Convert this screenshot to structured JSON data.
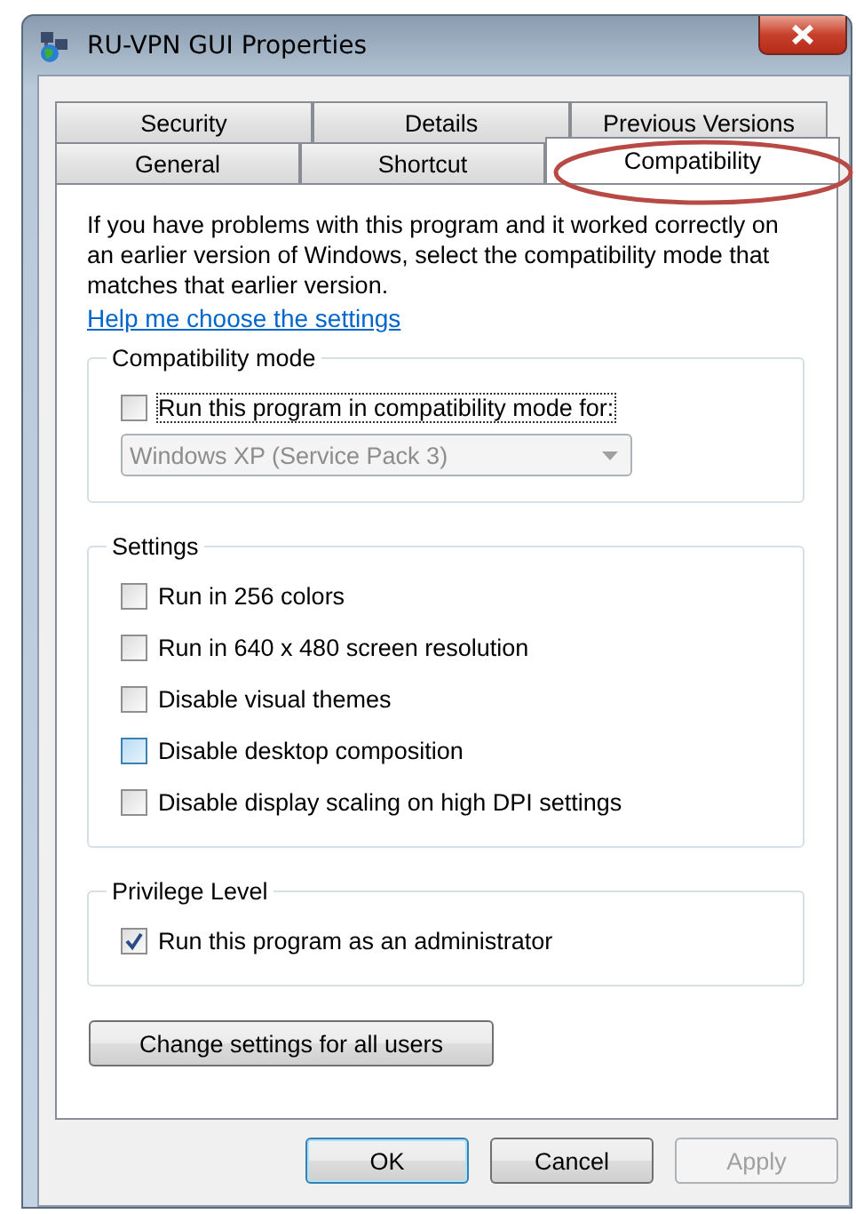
{
  "window": {
    "title": "RU-VPN GUI Properties"
  },
  "tab_rows": [
    [
      {
        "label": "Security",
        "selected": false
      },
      {
        "label": "Details",
        "selected": false
      },
      {
        "label": "Previous Versions",
        "selected": false
      }
    ],
    [
      {
        "label": "General",
        "selected": false
      },
      {
        "label": "Shortcut",
        "selected": false
      },
      {
        "label": "Compatibility",
        "selected": true,
        "circled": true
      }
    ]
  ],
  "intro": "If you have problems with this program and it worked correctly on an earlier version of Windows, select the compatibility mode that matches that earlier version.",
  "help_link": "Help me choose the settings",
  "groups": [
    {
      "title": "Compatibility mode",
      "checkboxes": [
        {
          "label": "Run this program in compatibility mode for:",
          "checked": false,
          "hovered": false,
          "focused": true
        }
      ],
      "dropdown": {
        "value": "Windows XP (Service Pack 3)",
        "disabled": true
      }
    },
    {
      "title": "Settings",
      "checkboxes": [
        {
          "label": "Run in 256 colors",
          "checked": false,
          "hovered": false,
          "focused": false
        },
        {
          "label": "Run in 640 x 480 screen resolution",
          "checked": false,
          "hovered": false,
          "focused": false
        },
        {
          "label": "Disable visual themes",
          "checked": false,
          "hovered": false,
          "focused": false
        },
        {
          "label": "Disable desktop composition",
          "checked": false,
          "hovered": true,
          "focused": false
        },
        {
          "label": "Disable display scaling on high DPI settings",
          "checked": false,
          "hovered": false,
          "focused": false
        }
      ]
    },
    {
      "title": "Privilege Level",
      "checkboxes": [
        {
          "label": "Run this program as an administrator",
          "checked": true,
          "hovered": false,
          "focused": false
        }
      ]
    }
  ],
  "all_users_button": "Change settings for all users",
  "buttons": [
    {
      "label": "OK",
      "default": true,
      "disabled": false
    },
    {
      "label": "Cancel",
      "default": false,
      "disabled": false
    },
    {
      "label": "Apply",
      "default": false,
      "disabled": true
    }
  ]
}
